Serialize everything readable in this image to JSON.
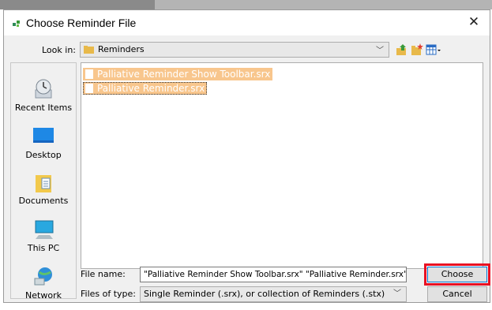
{
  "dialog": {
    "title": "Choose Reminder File",
    "close_glyph": "✕"
  },
  "lookin": {
    "label": "Look in:",
    "value": "Reminders"
  },
  "toolbar": {
    "icons": [
      "up-folder-icon",
      "new-folder-icon",
      "view-menu-icon"
    ]
  },
  "places": [
    {
      "label": "Recent Items",
      "icon": "recent-items-icon"
    },
    {
      "label": "Desktop",
      "icon": "desktop-icon"
    },
    {
      "label": "Documents",
      "icon": "documents-icon"
    },
    {
      "label": "This PC",
      "icon": "this-pc-icon"
    },
    {
      "label": "Network",
      "icon": "network-icon"
    }
  ],
  "files": [
    {
      "name": "Palliative Reminder Show Toolbar.srx",
      "selected": true
    },
    {
      "name": "Palliative Reminder.srx",
      "selected": true
    }
  ],
  "filename": {
    "label": "File name:",
    "value": "\"Palliative Reminder Show Toolbar.srx\" \"Palliative Reminder.srx\""
  },
  "filetype": {
    "label": "Files of type:",
    "value": "Single Reminder (.srx), or collection of Reminders (.stx)"
  },
  "buttons": {
    "choose": "Choose",
    "cancel": "Cancel"
  },
  "colors": {
    "selection": "#f8c68d",
    "highlight_box": "#e81123"
  }
}
